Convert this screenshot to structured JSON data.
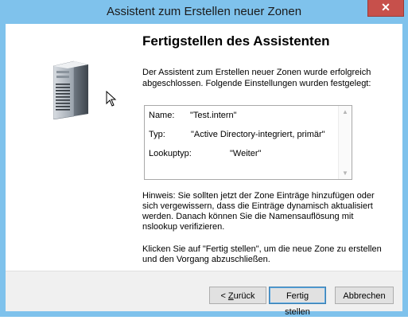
{
  "window": {
    "title": "Assistent zum Erstellen neuer Zonen",
    "close_glyph": "✕"
  },
  "page": {
    "heading": "Fertigstellen des Assistenten",
    "intro": "Der Assistent zum Erstellen neuer Zonen wurde erfolgreich abgeschlossen. Folgende Einstellungen wurden festgelegt:",
    "summary": {
      "name_label": "Name:",
      "name_value": "\"Test.intern\"",
      "type_label": "Typ:",
      "type_value": "\"Active Directory-integriert, primär\"",
      "lookup_label": "Lookuptyp:",
      "lookup_value": "\"Weiter\""
    },
    "note": "Hinweis: Sie sollten jetzt der Zone Einträge hinzufügen oder sich vergewissern, dass die Einträge dynamisch aktualisiert werden. Danach können Sie die Namensauflösung mit nslookup verifizieren.",
    "final_text": "Klicken Sie auf \"Fertig stellen\", um die neue Zone zu erstellen und den Vorgang abzuschließen."
  },
  "buttons": {
    "back_prefix": "< ",
    "back_mnemonic": "Z",
    "back_rest": "urück",
    "finish": "Fertig stellen",
    "cancel": "Abbrechen"
  },
  "colors": {
    "titlebar": "#7fc2ec",
    "close": "#c7504b"
  },
  "icons": {
    "wizard_image": "server-icon",
    "pointer": "mouse-cursor-icon"
  }
}
